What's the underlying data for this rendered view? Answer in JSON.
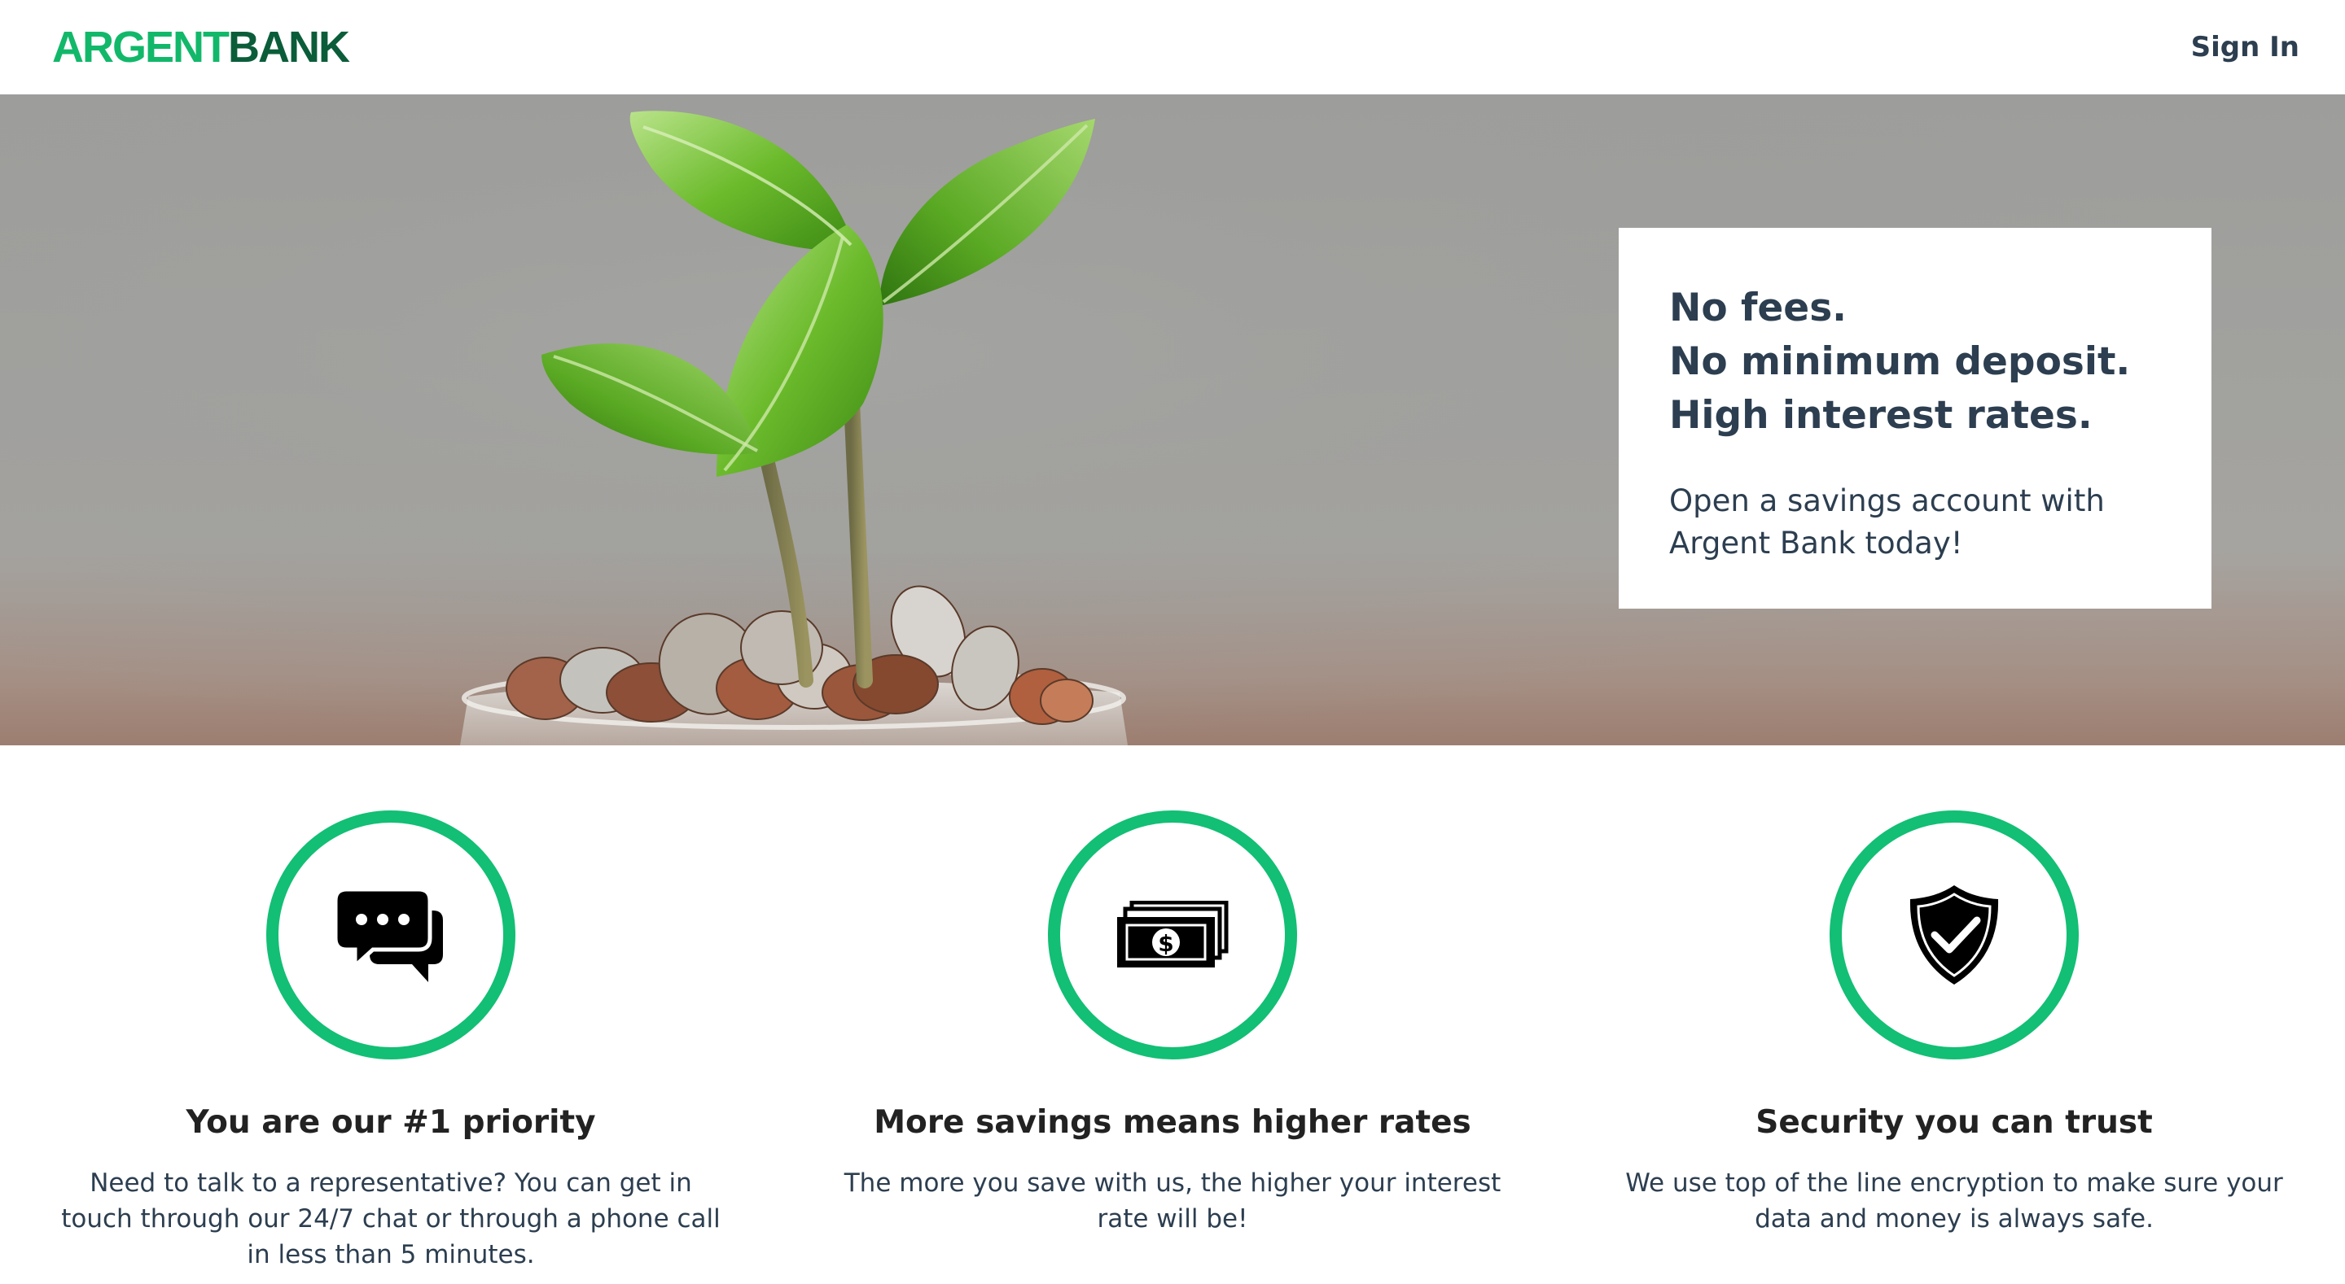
{
  "header": {
    "logo_part1": "ARGENT",
    "logo_part2": "BANK",
    "sign_in": "Sign In"
  },
  "hero": {
    "headline": [
      "No fees.",
      "No minimum deposit.",
      "High interest rates."
    ],
    "subtext": "Open a savings account with Argent Bank today!"
  },
  "features": [
    {
      "icon": "chat-icon",
      "title": "You are our #1 priority",
      "text": "Need to talk to a representative? You can get in touch through our 24/7 chat or through a phone call in less than 5 minutes."
    },
    {
      "icon": "money-icon",
      "title": "More savings means higher rates",
      "text": "The more you save with us, the higher your interest rate will be!"
    },
    {
      "icon": "security-icon",
      "title": "Security you can trust",
      "text": "We use top of the line encryption to make sure your data and money is always safe."
    }
  ],
  "colors": {
    "brand_green": "#12bf74",
    "brand_dark_green": "#0b5d3a",
    "text": "#2c3e50"
  }
}
